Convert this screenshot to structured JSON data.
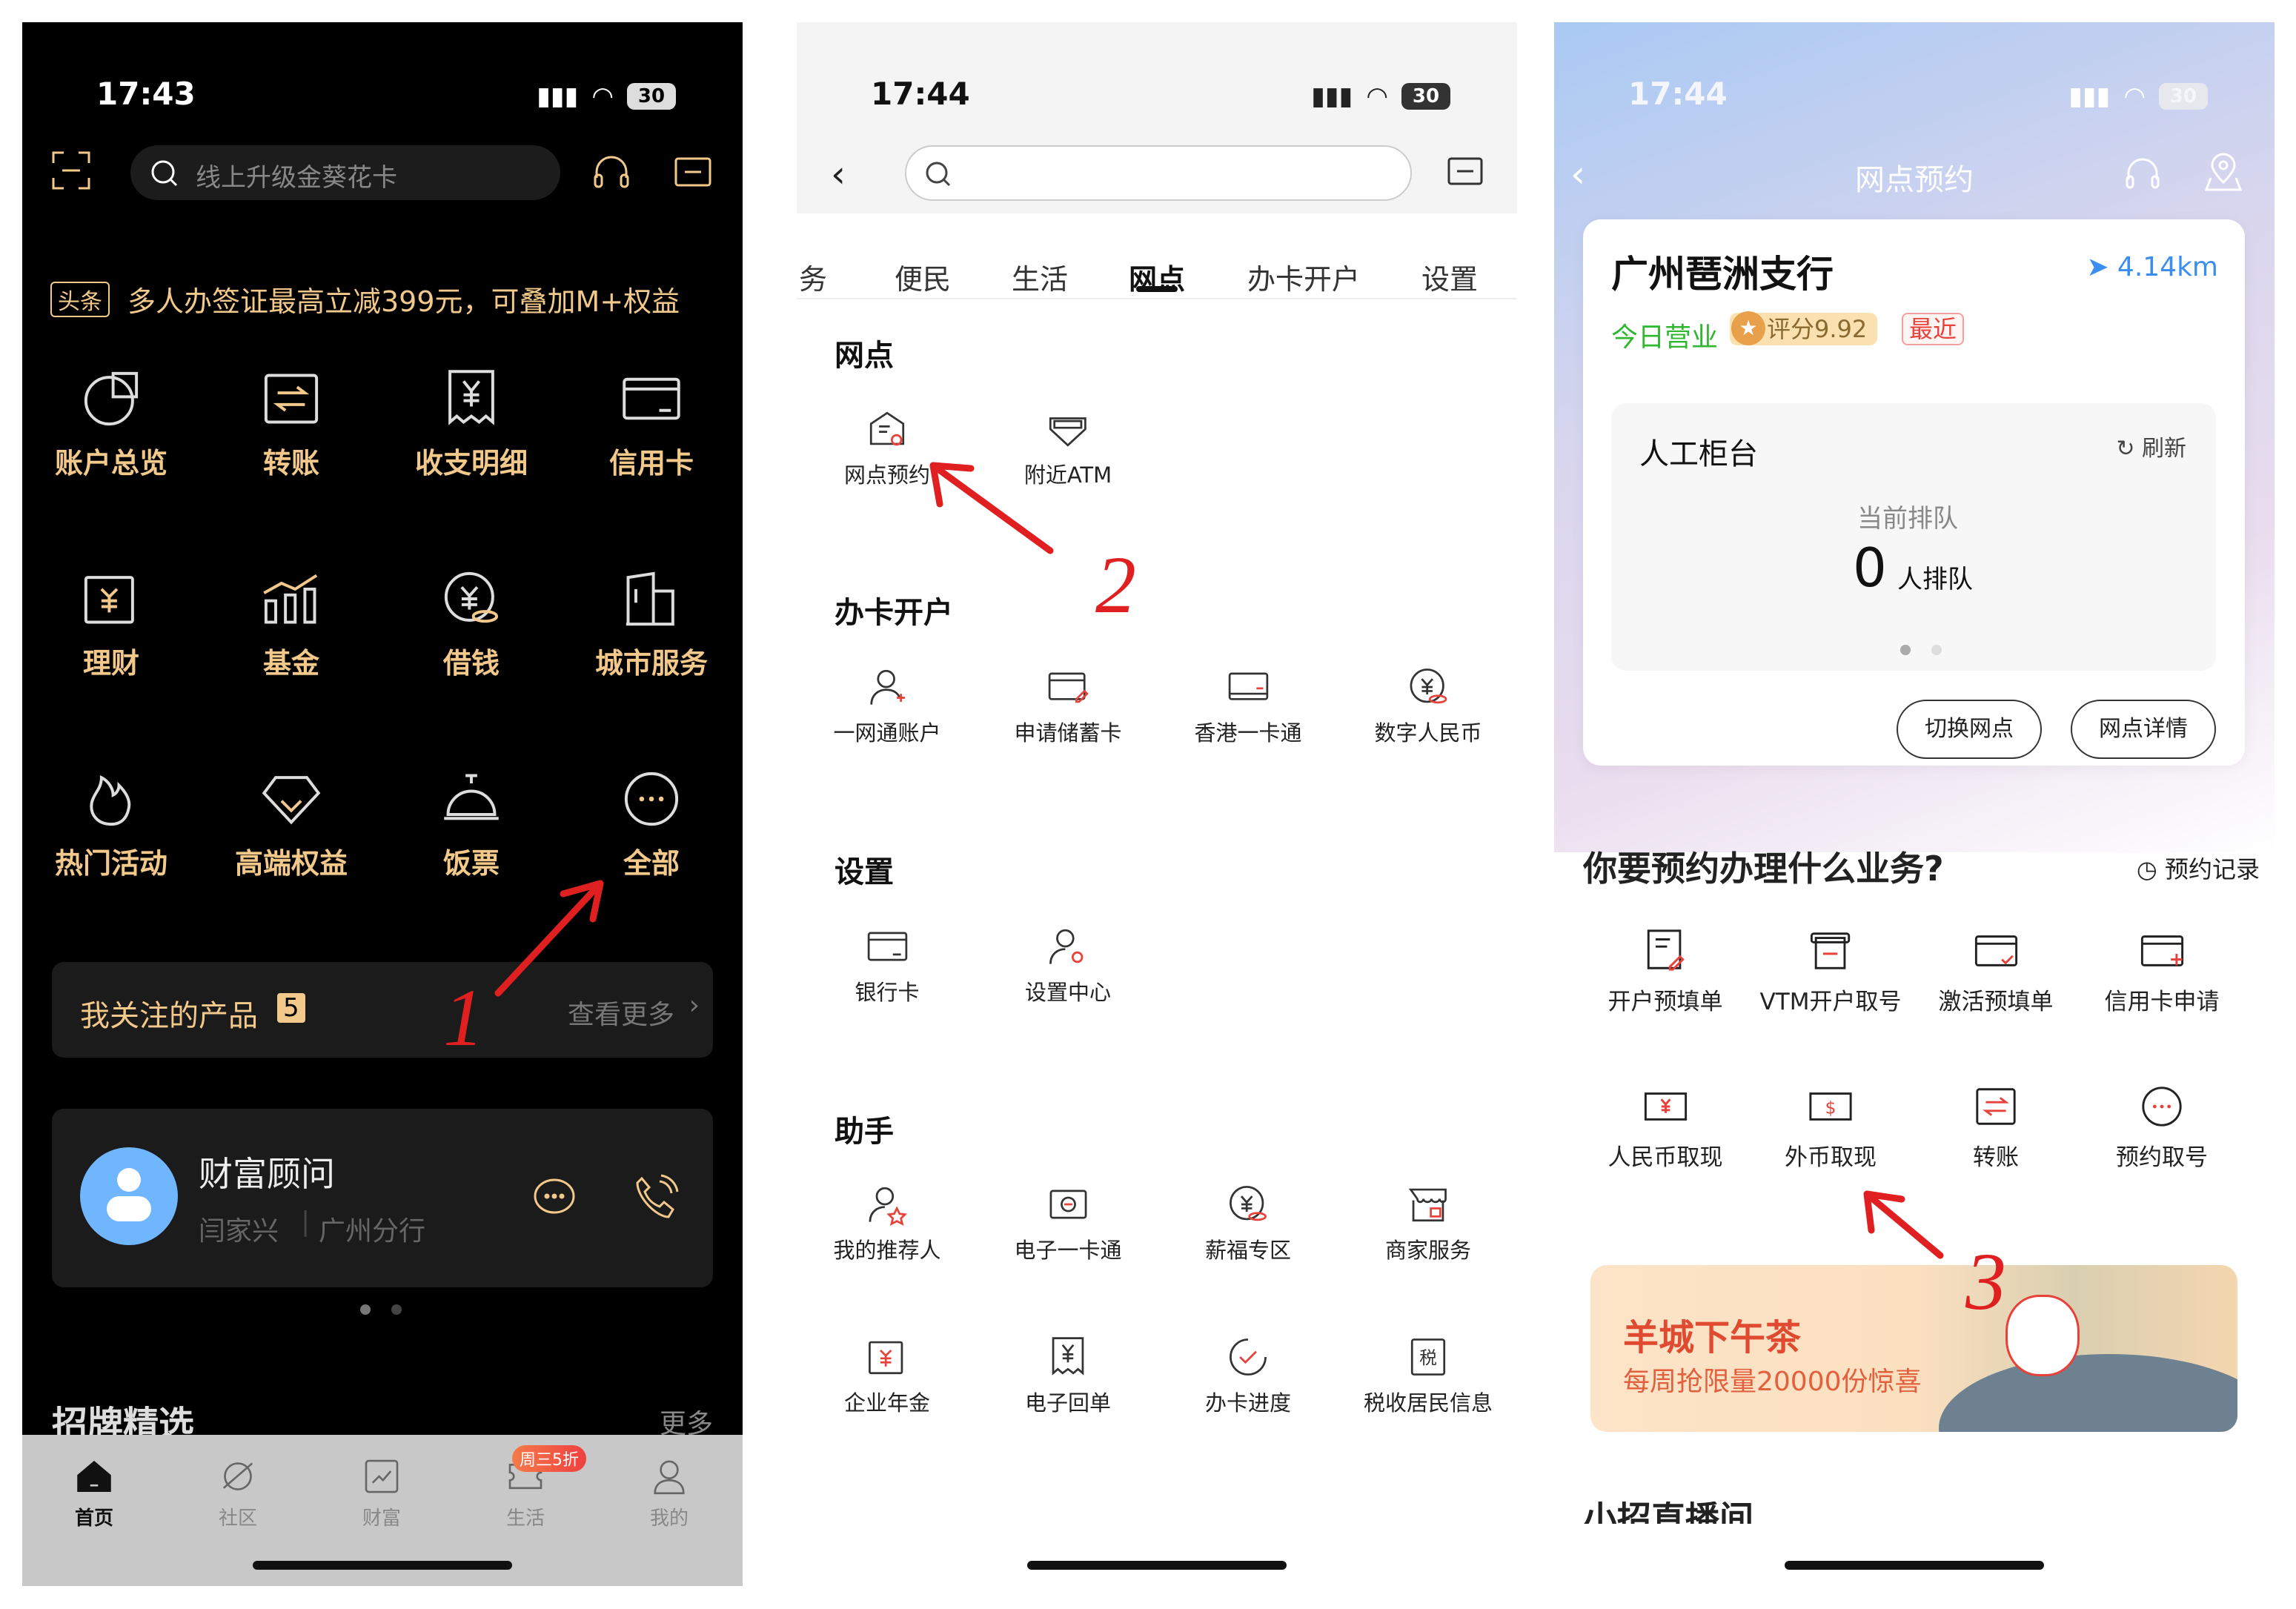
{
  "colors": {
    "gold": "#f2c98a",
    "annotation": "#e02020",
    "blue": "#3a8ef0",
    "green": "#2fb82f",
    "red": "#e8413a"
  },
  "home": {
    "status": {
      "time": "17:43",
      "battery": "30"
    },
    "search_placeholder": "线上升级金葵花卡",
    "headline_tag": "头条",
    "headline": "多人办签证最高立减399元，可叠加M+权益",
    "grid": [
      {
        "label": "账户总览",
        "icon": "pie"
      },
      {
        "label": "转账",
        "icon": "transfer"
      },
      {
        "label": "收支明细",
        "icon": "receipt"
      },
      {
        "label": "信用卡",
        "icon": "card"
      },
      {
        "label": "理财",
        "icon": "yuan-doc"
      },
      {
        "label": "基金",
        "icon": "chart"
      },
      {
        "label": "借钱",
        "icon": "yuan-coin"
      },
      {
        "label": "城市服务",
        "icon": "building"
      },
      {
        "label": "热门活动",
        "icon": "flame"
      },
      {
        "label": "高端权益",
        "icon": "diamond"
      },
      {
        "label": "饭票",
        "icon": "bell"
      },
      {
        "label": "全部",
        "icon": "dots"
      }
    ],
    "products": {
      "label": "我关注的产品",
      "count": "5",
      "more": "查看更多"
    },
    "advisor": {
      "title": "财富顾问",
      "name": "闫家兴",
      "branch": "广州分行"
    },
    "section": {
      "title": "招牌精选",
      "more": "更多"
    },
    "tabbar": [
      {
        "label": "首页",
        "icon": "home",
        "active": true
      },
      {
        "label": "社区",
        "icon": "planet"
      },
      {
        "label": "财富",
        "icon": "wealth"
      },
      {
        "label": "生活",
        "icon": "ticket",
        "badge": "周三5折"
      },
      {
        "label": "我的",
        "icon": "person"
      }
    ]
  },
  "services": {
    "status": {
      "time": "17:44",
      "battery": "30"
    },
    "tabs": [
      "务",
      "便民",
      "生活",
      "网点",
      "办卡开户",
      "设置"
    ],
    "active_tab": "网点",
    "sections": [
      {
        "title": "网点",
        "items": [
          {
            "label": "网点预约",
            "icon": "bank"
          },
          {
            "label": "附近ATM",
            "icon": "atm"
          }
        ]
      },
      {
        "title": "办卡开户",
        "items": [
          {
            "label": "一网通账户",
            "icon": "person-plus"
          },
          {
            "label": "申请储蓄卡",
            "icon": "card-pen"
          },
          {
            "label": "香港一卡通",
            "icon": "hk-card"
          },
          {
            "label": "数字人民币",
            "icon": "yuan-coin"
          }
        ]
      },
      {
        "title": "设置",
        "items": [
          {
            "label": "银行卡",
            "icon": "card"
          },
          {
            "label": "设置中心",
            "icon": "person-gear"
          }
        ]
      },
      {
        "title": "助手",
        "items": [
          {
            "label": "我的推荐人",
            "icon": "person-star"
          },
          {
            "label": "电子一卡通",
            "icon": "card-scan"
          },
          {
            "label": "薪福专区",
            "icon": "yuan-coin"
          },
          {
            "label": "商家服务",
            "icon": "shop"
          },
          {
            "label": "企业年金",
            "icon": "yuan-doc"
          },
          {
            "label": "电子回单",
            "icon": "receipt"
          },
          {
            "label": "办卡进度",
            "icon": "progress"
          },
          {
            "label": "税收居民信息",
            "icon": "tax"
          }
        ]
      }
    ]
  },
  "booking": {
    "status": {
      "time": "17:44",
      "battery": "30"
    },
    "title": "网点预约",
    "branch": {
      "name": "广州琶洲支行",
      "distance": "4.14km",
      "open": "今日营业",
      "rating": "评分9.92",
      "tag": "最近"
    },
    "queue": {
      "title": "人工柜台",
      "refresh": "刷新",
      "label": "当前排队",
      "count": "0",
      "unit": "人排队"
    },
    "buttons": {
      "switch": "切换网点",
      "detail": "网点详情"
    },
    "question": "你要预约办理什么业务?",
    "records": "预约记录",
    "grid": [
      {
        "label": "开户预填单",
        "icon": "doc-pen"
      },
      {
        "label": "VTM开户取号",
        "icon": "vtm"
      },
      {
        "label": "激活预填单",
        "icon": "card-check"
      },
      {
        "label": "信用卡申请",
        "icon": "card-plus"
      },
      {
        "label": "人民币取现",
        "icon": "cash-yuan"
      },
      {
        "label": "外币取现",
        "icon": "cash-dollar"
      },
      {
        "label": "转账",
        "icon": "transfer"
      },
      {
        "label": "预约取号",
        "icon": "dots"
      }
    ],
    "banner": {
      "title": "羊城下午茶",
      "subtitle": "每周抢限量20000份惊喜"
    },
    "next_section": "小招直播间"
  },
  "annotations": [
    "1",
    "2",
    "3"
  ]
}
